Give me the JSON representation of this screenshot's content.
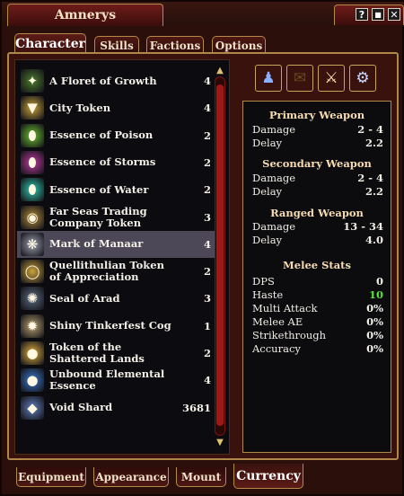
{
  "window": {
    "title": "Amnerys"
  },
  "window_controls": [
    {
      "name": "help-button",
      "glyph": "?"
    },
    {
      "name": "minimize-button",
      "glyph": "■"
    },
    {
      "name": "close-button",
      "glyph": "✕"
    }
  ],
  "top_tabs": [
    {
      "label": "Character",
      "active": true
    },
    {
      "label": "Skills",
      "active": false
    },
    {
      "label": "Factions",
      "active": false
    },
    {
      "label": "Options",
      "active": false
    }
  ],
  "currency_items": [
    {
      "name": "A Floret of Growth",
      "qty": "4",
      "icon": "leaf-icon",
      "color": "#4a7a2a",
      "glyph": "✦"
    },
    {
      "name": "City Token",
      "qty": "4",
      "icon": "token-icon",
      "color": "#c9a23a",
      "glyph": "▼"
    },
    {
      "name": "Essence of Poison",
      "qty": "2",
      "icon": "poison-essence-icon",
      "color": "#6bbf2e",
      "glyph": "⬮"
    },
    {
      "name": "Essence of Storms",
      "qty": "2",
      "icon": "storm-essence-icon",
      "color": "#c03aa0",
      "glyph": "⬮"
    },
    {
      "name": "Essence of Water",
      "qty": "2",
      "icon": "water-essence-icon",
      "color": "#2fc8b0",
      "glyph": "⬮"
    },
    {
      "name": "Far Seas Trading Company Token",
      "qty": "3",
      "icon": "coin-icon",
      "color": "#b08a3a",
      "glyph": "◉"
    },
    {
      "name": "Mark of Manaar",
      "qty": "4",
      "icon": "mark-icon",
      "color": "#9aa0b0",
      "glyph": "❋"
    },
    {
      "name": "Quellithulian Token of Appreciation",
      "qty": "2",
      "icon": "ring-icon",
      "color": "#c9a23a",
      "glyph": "◯"
    },
    {
      "name": "Seal of Arad",
      "qty": "3",
      "icon": "seal-icon",
      "color": "#5a6a80",
      "glyph": "✺"
    },
    {
      "name": "Shiny Tinkerfest Cog",
      "qty": "1",
      "icon": "cog-icon",
      "color": "#b8a070",
      "glyph": "✹"
    },
    {
      "name": "Token of the Shattered Lands",
      "qty": "2",
      "icon": "shattered-token-icon",
      "color": "#e0b040",
      "glyph": "●"
    },
    {
      "name": "Unbound Elemental Essence",
      "qty": "4",
      "icon": "orb-icon",
      "color": "#3a7ad0",
      "glyph": "●"
    },
    {
      "name": "Void Shard",
      "qty": "3681",
      "icon": "shard-icon",
      "color": "#6080c0",
      "glyph": "◆"
    }
  ],
  "selected_item": "Mark of Manaar",
  "panel_buttons": [
    {
      "icon": "character-figure-icon",
      "color": "#2a3a9a",
      "glyph": "♟"
    },
    {
      "icon": "scroll-icon",
      "color": "#d8c59a",
      "glyph": "✉"
    },
    {
      "icon": "crossed-swords-icon",
      "color": "#b4441e",
      "glyph": "⚔"
    },
    {
      "icon": "gears-icon",
      "color": "#2a4fa0",
      "glyph": "⚙"
    }
  ],
  "stats": {
    "primary": {
      "title": "Primary Weapon",
      "damage_label": "Damage",
      "damage": "2 - 4",
      "delay_label": "Delay",
      "delay": "2.2"
    },
    "secondary": {
      "title": "Secondary Weapon",
      "damage_label": "Damage",
      "damage": "2 - 4",
      "delay_label": "Delay",
      "delay": "2.2"
    },
    "ranged": {
      "title": "Ranged Weapon",
      "damage_label": "Damage",
      "damage": "13 - 34",
      "delay_label": "Delay",
      "delay": "4.0"
    },
    "melee": {
      "title": "Melee Stats",
      "rows": [
        {
          "label": "DPS",
          "value": "0"
        },
        {
          "label": "Haste",
          "value": "10"
        },
        {
          "label": "Multi Attack",
          "value": "0%"
        },
        {
          "label": "Melee AE",
          "value": "0%"
        },
        {
          "label": "Strikethrough",
          "value": "0%"
        },
        {
          "label": "Accuracy",
          "value": "0%"
        }
      ]
    }
  },
  "bottom_tabs": [
    {
      "label": "Equipment",
      "active": false
    },
    {
      "label": "Appearance",
      "active": false
    },
    {
      "label": "Mount",
      "active": false
    },
    {
      "label": "Currency",
      "active": true
    }
  ],
  "colors": {
    "haste_value": "#58e03a",
    "accent_gold": "#b0874a",
    "selected_row": "#4d4858"
  }
}
